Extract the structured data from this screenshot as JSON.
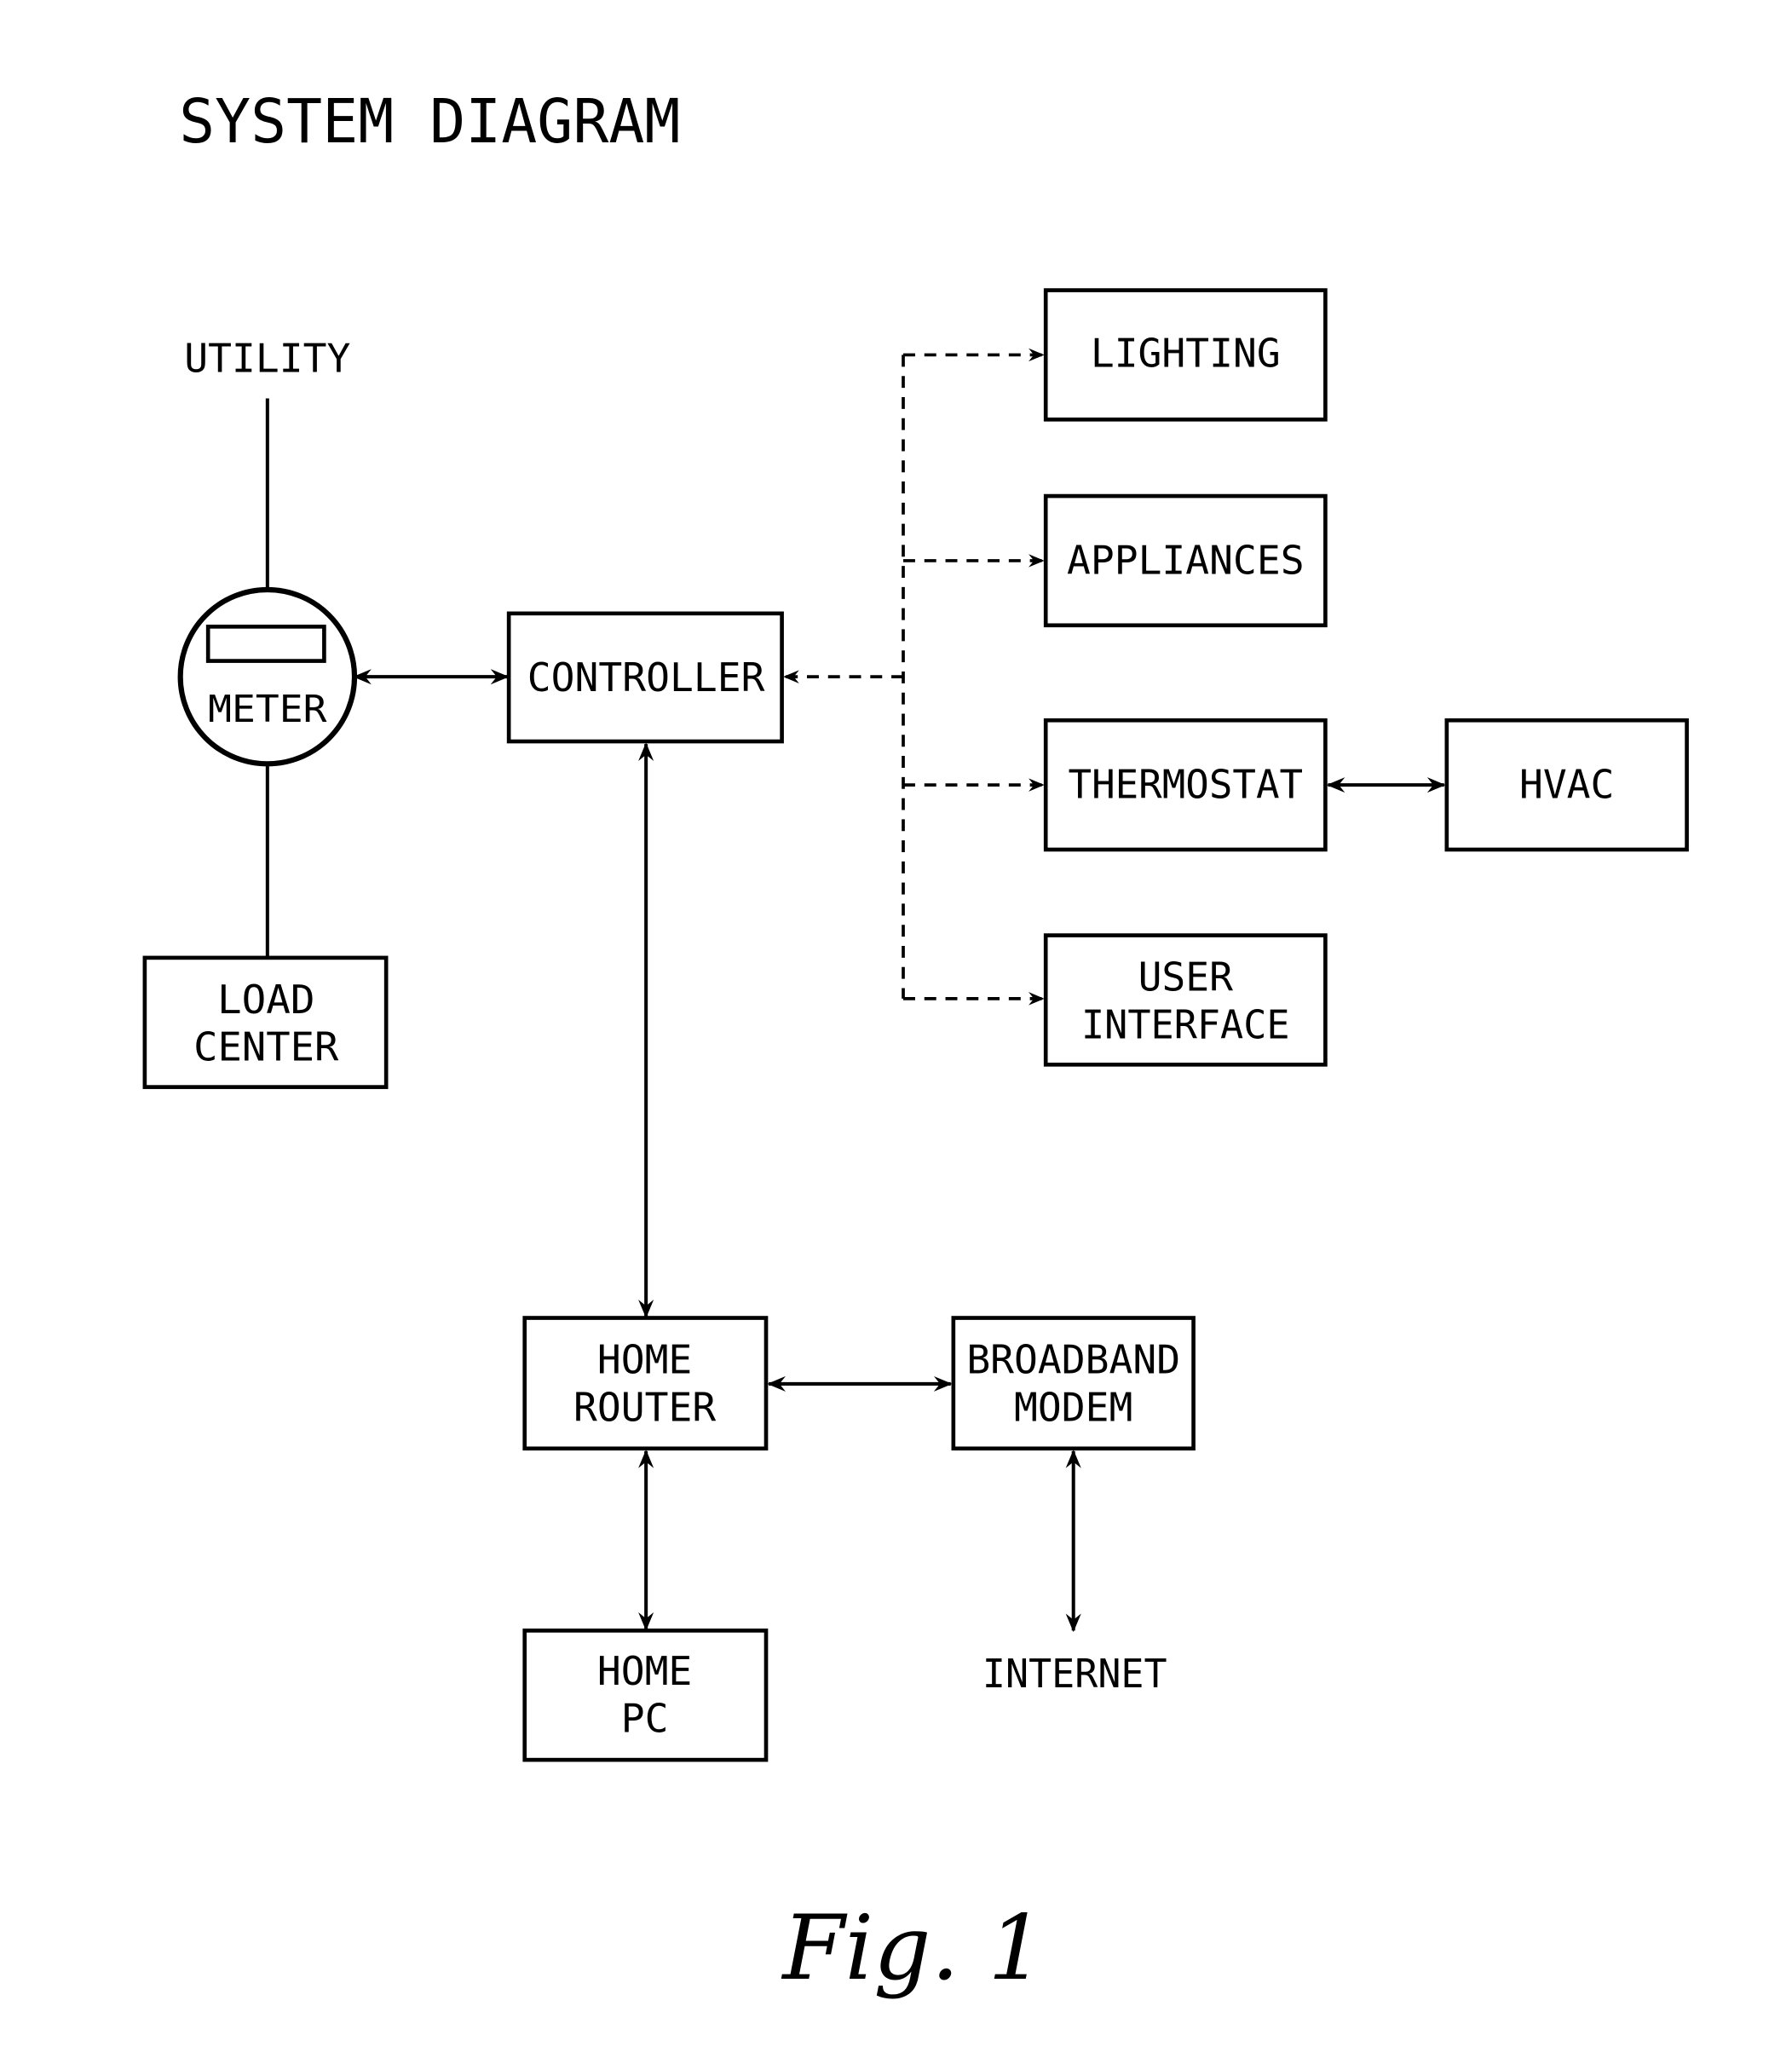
{
  "title": "SYSTEM DIAGRAM",
  "figure_label": "Fig. 1",
  "colors": {
    "ink": "#000000",
    "background": "#ffffff"
  },
  "labels": {
    "utility": "UTILITY",
    "internet": "INTERNET"
  },
  "nodes": {
    "meter": {
      "lines": [
        "METER"
      ]
    },
    "load_center": {
      "lines": [
        "LOAD",
        "CENTER"
      ]
    },
    "controller": {
      "lines": [
        "CONTROLLER"
      ]
    },
    "lighting": {
      "lines": [
        "LIGHTING"
      ]
    },
    "appliances": {
      "lines": [
        "APPLIANCES"
      ]
    },
    "thermostat": {
      "lines": [
        "THERMOSTAT"
      ]
    },
    "hvac": {
      "lines": [
        "HVAC"
      ]
    },
    "user_interface": {
      "lines": [
        "USER",
        "INTERFACE"
      ]
    },
    "home_router": {
      "lines": [
        "HOME",
        "ROUTER"
      ]
    },
    "broadband_modem": {
      "lines": [
        "BROADBAND",
        "MODEM"
      ]
    },
    "home_pc": {
      "lines": [
        "HOME",
        "PC"
      ]
    }
  },
  "connections": [
    {
      "from": "UTILITY",
      "to": "METER",
      "style": "solid",
      "arrows": "none"
    },
    {
      "from": "METER",
      "to": "LOAD CENTER",
      "style": "solid",
      "arrows": "none"
    },
    {
      "from": "METER",
      "to": "CONTROLLER",
      "style": "solid",
      "arrows": "both"
    },
    {
      "from": "CONTROLLER",
      "to": "LIGHTING",
      "style": "dashed",
      "arrows": "both"
    },
    {
      "from": "CONTROLLER",
      "to": "APPLIANCES",
      "style": "dashed",
      "arrows": "both"
    },
    {
      "from": "CONTROLLER",
      "to": "THERMOSTAT",
      "style": "dashed",
      "arrows": "both"
    },
    {
      "from": "CONTROLLER",
      "to": "USER INTERFACE",
      "style": "dashed",
      "arrows": "both"
    },
    {
      "from": "THERMOSTAT",
      "to": "HVAC",
      "style": "solid",
      "arrows": "both"
    },
    {
      "from": "CONTROLLER",
      "to": "HOME ROUTER",
      "style": "solid",
      "arrows": "both"
    },
    {
      "from": "HOME ROUTER",
      "to": "BROADBAND MODEM",
      "style": "solid",
      "arrows": "both"
    },
    {
      "from": "HOME ROUTER",
      "to": "HOME PC",
      "style": "solid",
      "arrows": "both"
    },
    {
      "from": "BROADBAND MODEM",
      "to": "INTERNET",
      "style": "solid",
      "arrows": "both"
    }
  ]
}
